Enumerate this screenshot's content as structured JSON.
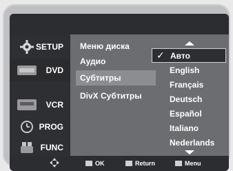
{
  "sidebar": {
    "items": [
      {
        "label": "SETUP",
        "icon": "gear-icon"
      },
      {
        "label": "DVD",
        "icon": "dvd-icon"
      },
      {
        "label": "VCR",
        "icon": "vcr-icon"
      },
      {
        "label": "PROG",
        "icon": "clock-icon"
      },
      {
        "label": "FUNC",
        "icon": "function-icon"
      }
    ]
  },
  "menu": {
    "items": [
      {
        "label": "Меню диска"
      },
      {
        "label": "Аудио"
      },
      {
        "label": "Субтитры"
      },
      {
        "label": "DivX Субтитры"
      }
    ]
  },
  "dropdown": {
    "options": [
      {
        "label": "Авто",
        "checked": true
      },
      {
        "label": "English"
      },
      {
        "label": "Français"
      },
      {
        "label": "Deutsch"
      },
      {
        "label": "Español"
      },
      {
        "label": "Italiano"
      },
      {
        "label": "Nederlands"
      }
    ],
    "check_mark": "✓"
  },
  "footer": {
    "ok": "OK",
    "return": "Return",
    "menu": "Menu"
  }
}
